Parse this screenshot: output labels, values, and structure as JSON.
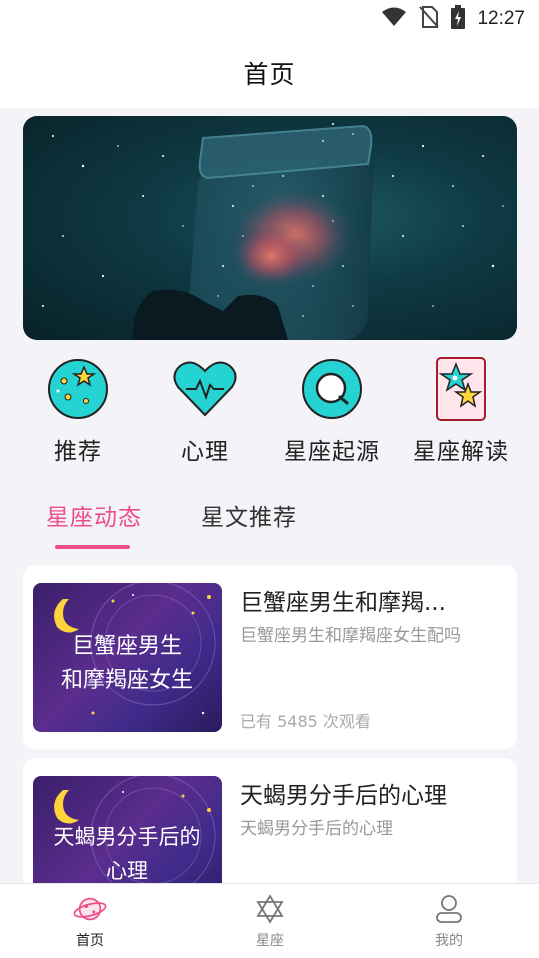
{
  "status_bar": {
    "time": "12:27"
  },
  "header": {
    "title": "首页"
  },
  "categories": [
    {
      "label": "推荐",
      "icon": "planet-stars-icon"
    },
    {
      "label": "心理",
      "icon": "heart-pulse-icon"
    },
    {
      "label": "星座起源",
      "icon": "search-bubble-icon"
    },
    {
      "label": "星座解读",
      "icon": "star-card-icon"
    }
  ],
  "tabs": [
    {
      "label": "星座动态",
      "active": true
    },
    {
      "label": "星文推荐",
      "active": false
    }
  ],
  "articles": [
    {
      "title": "巨蟹座男生和摩羯...",
      "subtitle": "巨蟹座男生和摩羯座女生配吗",
      "views": "已有 5485 次观看",
      "thumb_line1": "巨蟹座男生",
      "thumb_line2": "和摩羯座女生"
    },
    {
      "title": "天蝎男分手后的心理",
      "subtitle": "天蝎男分手后的心理",
      "views": "",
      "thumb_line1": "天蝎男分手后的",
      "thumb_line2": "心理"
    }
  ],
  "bottom_nav": [
    {
      "label": "首页",
      "icon": "planet-icon",
      "active": true
    },
    {
      "label": "星座",
      "icon": "star-of-david-icon",
      "active": false
    },
    {
      "label": "我的",
      "icon": "user-icon",
      "active": false
    }
  ],
  "colors": {
    "accent": "#ee4d8c",
    "teal": "#26d3d3",
    "background": "#f4f4f8"
  }
}
